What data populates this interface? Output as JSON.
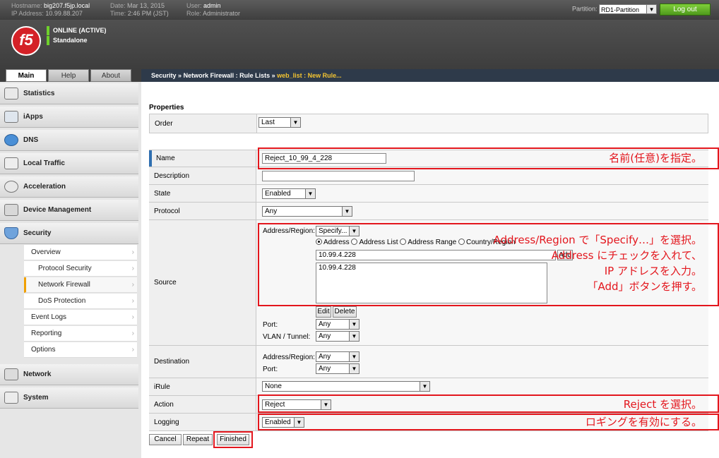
{
  "topbar": {
    "hostname_label": "Hostname:",
    "hostname": "big207.f5jp.local",
    "ip_label": "IP Address:",
    "ip": "10.99.88.207",
    "date_label": "Date:",
    "date": "Mar 13, 2015",
    "time_label": "Time:",
    "time": "2:46 PM (JST)",
    "user_label": "User:",
    "user": "admin",
    "role_label": "Role:",
    "role": "Administrator",
    "partition_label": "Partition:",
    "partition_value": "RD1-Partition",
    "logout": "Log out"
  },
  "header": {
    "logo": "f5",
    "status_line1": "ONLINE (ACTIVE)",
    "status_line2": "Standalone"
  },
  "tabs": [
    "Main",
    "Help",
    "About"
  ],
  "breadcrumb": {
    "part1": "Security",
    "sep": "»",
    "part2": "Network Firewall : Rule Lists",
    "part3": "web_list : New Rule..."
  },
  "sidebar": {
    "items": [
      {
        "label": "Statistics",
        "icon": "statistics-icon"
      },
      {
        "label": "iApps",
        "icon": "iapps-icon"
      },
      {
        "label": "DNS",
        "icon": "dns-icon"
      },
      {
        "label": "Local Traffic",
        "icon": "local-traffic-icon"
      },
      {
        "label": "Acceleration",
        "icon": "acceleration-icon"
      },
      {
        "label": "Device Management",
        "icon": "device-management-icon"
      },
      {
        "label": "Security",
        "icon": "security-icon"
      },
      {
        "label": "Network",
        "icon": "network-icon"
      },
      {
        "label": "System",
        "icon": "system-icon"
      }
    ],
    "security_sub": [
      "Overview",
      "Protocol Security",
      "Network Firewall",
      "DoS Protection",
      "Event Logs",
      "Reporting",
      "Options"
    ]
  },
  "form": {
    "properties_title": "Properties",
    "order_label": "Order",
    "order_value": "Last",
    "name_label": "Name",
    "name_value": "Reject_10_99_4_228",
    "description_label": "Description",
    "description_value": "",
    "state_label": "State",
    "state_value": "Enabled",
    "protocol_label": "Protocol",
    "protocol_value": "Any",
    "source_label": "Source",
    "address_region_label": "Address/Region:",
    "address_region_value": "Specify...",
    "radio_address": "Address",
    "radio_address_list": "Address List",
    "radio_address_range": "Address Range",
    "radio_country": "Country/Region",
    "address_input": "10.99.4.228",
    "add_button": "Add",
    "address_list_item": "10.99.4.228",
    "edit_button": "Edit",
    "delete_button": "Delete",
    "port_label": "Port:",
    "port_value": "Any",
    "vlan_label": "VLAN / Tunnel:",
    "vlan_value": "Any",
    "destination_label": "Destination",
    "dest_address_region_value": "Any",
    "dest_port_value": "Any",
    "irule_label": "iRule",
    "irule_value": "None",
    "action_label": "Action",
    "action_value": "Reject",
    "logging_label": "Logging",
    "logging_value": "Enabled",
    "cancel": "Cancel",
    "repeat": "Repeat",
    "finished": "Finished"
  },
  "annotations": {
    "name": "名前(任意)を指定。",
    "source_1": "Address/Region で「Specify…」を選択。",
    "source_2": "Address にチェックを入れて、",
    "source_3": "IP アドレスを入力。",
    "source_4": "「Add」ボタンを押す。",
    "action": "Reject を選択。",
    "logging": "ロギングを有効にする。",
    "color": "#e3161d"
  }
}
